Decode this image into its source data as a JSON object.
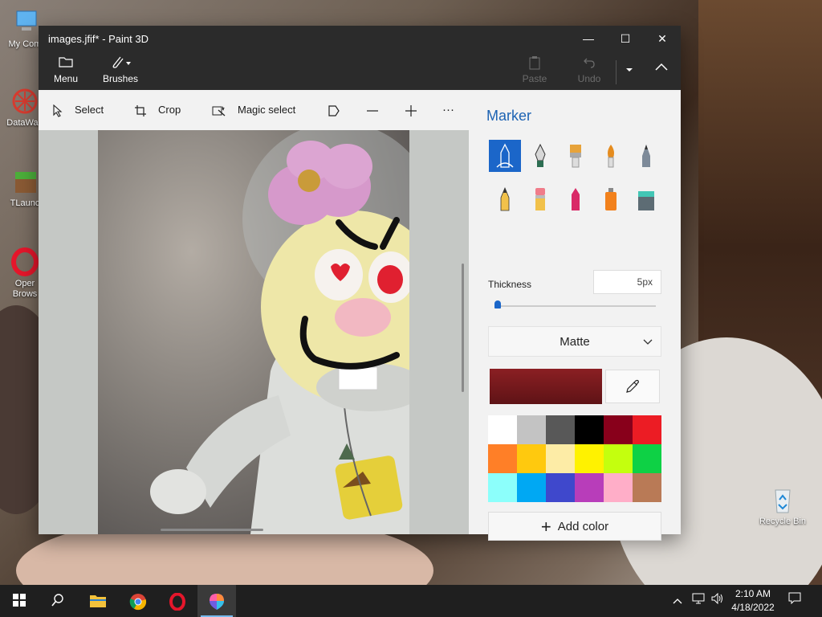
{
  "desktop": {
    "icons": [
      {
        "label": "My Com"
      },
      {
        "label": "DataWag"
      },
      {
        "label": "TLaunc"
      },
      {
        "label": "Oper Brows"
      },
      {
        "label": "Recycle Bin"
      }
    ]
  },
  "window": {
    "title": "images.jfif* - Paint 3D",
    "controls": {
      "minimize": "—",
      "maximize": "☐",
      "close": "✕"
    }
  },
  "ribbon": {
    "menu_label": "Menu",
    "brushes_label": "Brushes",
    "paste_label": "Paste",
    "undo_label": "Undo"
  },
  "toolbar": {
    "select_label": "Select",
    "crop_label": "Crop",
    "magic_select_label": "Magic select",
    "more_label": "···"
  },
  "panel": {
    "title": "Marker",
    "brushes": [
      {
        "name": "marker",
        "selected": true
      },
      {
        "name": "calligraphy-pen"
      },
      {
        "name": "oil-brush"
      },
      {
        "name": "watercolor"
      },
      {
        "name": "pixel-pen"
      },
      {
        "name": "pencil"
      },
      {
        "name": "eraser"
      },
      {
        "name": "crayon"
      },
      {
        "name": "spray-can"
      },
      {
        "name": "fill"
      }
    ],
    "thickness_label": "Thickness",
    "thickness_value": "5px",
    "thickness_level": 0.01,
    "finish": "Matte",
    "current_color": "#8b1f23",
    "palette": [
      "#ffffff",
      "#c3c3c3",
      "#585858",
      "#000000",
      "#88001b",
      "#ec1c24",
      "#ff7f27",
      "#ffc90e",
      "#fdeca6",
      "#fff200",
      "#c4ff0e",
      "#0ed145",
      "#8cfffb",
      "#00a8f3",
      "#3f48cc",
      "#b83dba",
      "#ffaec8",
      "#b97a56"
    ],
    "add_color_label": "Add color"
  },
  "taskbar": {
    "time": "2:10 AM",
    "date": "4/18/2022"
  }
}
